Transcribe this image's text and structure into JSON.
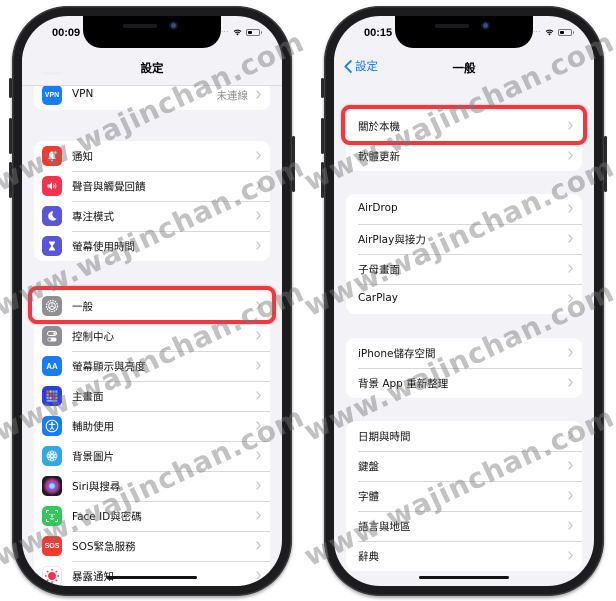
{
  "left_phone": {
    "status_bar": {
      "time": "00:09"
    },
    "nav": {
      "title": "設定"
    },
    "groups": [
      {
        "items": [
          {
            "label": "VPN",
            "value": "未連線",
            "icon": "vpn-icon",
            "icon_text": "VPN",
            "icon_color": "#1a7cf5"
          }
        ]
      },
      {
        "items": [
          {
            "label": "通知",
            "icon": "bell-icon",
            "icon_color": "#f23a30"
          },
          {
            "label": "聲音與觸覺回饋",
            "icon": "speaker-icon",
            "icon_color": "#f2334f"
          },
          {
            "label": "專注模式",
            "icon": "moon-icon",
            "icon_color": "#5a56d6"
          },
          {
            "label": "螢幕使用時間",
            "icon": "hourglass-icon",
            "icon_color": "#5a56d6"
          }
        ]
      },
      {
        "items": [
          {
            "label": "一般",
            "icon": "gear-icon",
            "icon_color": "#8e8e93",
            "highlighted": true
          },
          {
            "label": "控制中心",
            "icon": "toggles-icon",
            "icon_color": "#8e8e93"
          },
          {
            "label": "螢幕顯示與亮度",
            "icon": "text-size-icon",
            "icon_text": "AA",
            "icon_color": "#1a7cf5"
          },
          {
            "label": "主畫面",
            "icon": "home-grid-icon",
            "icon_color": "#2c3fd8"
          },
          {
            "label": "輔助使用",
            "icon": "accessibility-icon",
            "icon_color": "#1a7cf5"
          },
          {
            "label": "背景圖片",
            "icon": "flower-icon",
            "icon_color": "#35a8e0"
          },
          {
            "label": "Siri與搜尋",
            "icon": "siri-icon",
            "icon_color": "#1b1b2e"
          },
          {
            "label": "Face ID與密碼",
            "icon": "face-id-icon",
            "icon_color": "#34c759"
          },
          {
            "label": "SOS緊急服務",
            "icon": "sos-icon",
            "icon_text": "SOS",
            "icon_color": "#f23a30"
          },
          {
            "label": "暴露通知",
            "icon": "exposure-icon",
            "icon_color": "#ffffff"
          }
        ]
      }
    ]
  },
  "right_phone": {
    "status_bar": {
      "time": "00:15"
    },
    "nav": {
      "title": "一般",
      "back_label": "設定"
    },
    "groups": [
      {
        "items": [
          {
            "label": "關於本機",
            "highlighted": true
          },
          {
            "label": "軟體更新"
          }
        ]
      },
      {
        "items": [
          {
            "label": "AirDrop"
          },
          {
            "label": "AirPlay與接力"
          },
          {
            "label": "子母畫面"
          },
          {
            "label": "CarPlay"
          }
        ]
      },
      {
        "items": [
          {
            "label": "iPhone儲存空間"
          },
          {
            "label": "背景 App 重新整理"
          }
        ]
      },
      {
        "items": [
          {
            "label": "日期與時間"
          },
          {
            "label": "鍵盤"
          },
          {
            "label": "字體"
          },
          {
            "label": "語言與地區"
          },
          {
            "label": "辭典"
          }
        ]
      }
    ]
  },
  "colors": {
    "highlight": "#f0383f",
    "ios_blue": "#0a7aff",
    "background": "#f2f2f7"
  },
  "watermark": "www.wajinchan.com"
}
